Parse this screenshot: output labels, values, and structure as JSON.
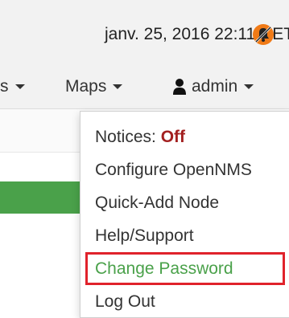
{
  "header": {
    "datetime": "janv. 25, 2016 22:11 CET",
    "notification_icon": "notifications-off-icon"
  },
  "nav": {
    "partial_label": "s",
    "maps_label": "Maps",
    "user_label": "admin",
    "user_icon": "user-icon"
  },
  "user_menu": {
    "notices_label": "Notices:",
    "notices_state": "Off",
    "items": [
      "Configure OpenNMS",
      "Quick-Add Node",
      "Help/Support",
      "Change Password",
      "Log Out"
    ],
    "highlighted_item": "Change Password"
  },
  "colors": {
    "accent_green": "#4aa14a",
    "highlight_red": "#e0222b",
    "off_red": "#a32020",
    "notification_orange": "#f07a16"
  }
}
